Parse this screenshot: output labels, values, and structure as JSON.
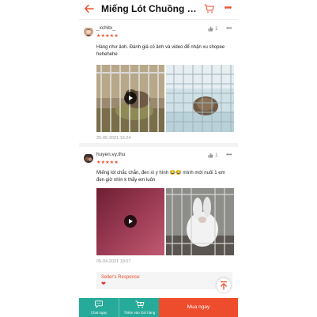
{
  "header": {
    "title": "Miếng Lót Chuồng Đen Giữ Ấm Cho Thỏ",
    "more_label": "•••"
  },
  "reviews": [
    {
      "username": "_xchitx_",
      "stars": "★★★★★",
      "likes": "1",
      "text": "Hàng như ảnh. Đánh giá có ảnh và video để nhận xu shopee hehehehe",
      "date": "25-05-2021 16:24"
    },
    {
      "username": "huyen.vy.thu",
      "stars": "★★★★★",
      "likes": "1",
      "text": "Miếng lót chắc chắn, đen xì y hình 😂😂 mình mới nuôi 1 em đen giờ nhìn k thấy em luôn",
      "date": "05-04-2021 19:07",
      "seller_response_label": "Seller's Response:",
      "seller_response_text": "❤"
    }
  ],
  "bottom_bar": {
    "chat_label": "Chat ngay",
    "add_cart_label": "Thêm vào Giỏ hàng",
    "buy_now_label": "Mua ngay"
  },
  "colors": {
    "brand": "#ee4d2d",
    "teal": "#26aa99"
  }
}
